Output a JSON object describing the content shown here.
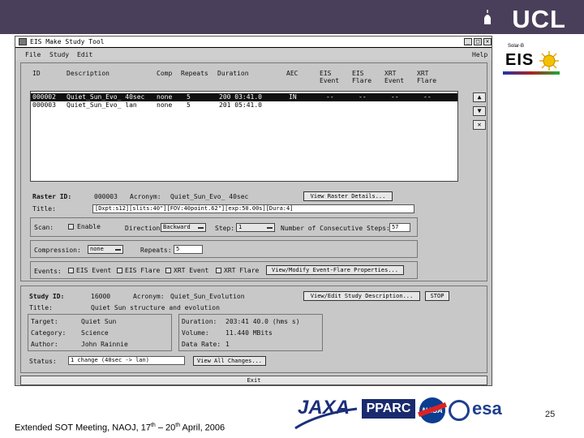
{
  "banner": {
    "logo": "UCL"
  },
  "eis_logo": {
    "small": "Solar-B",
    "text": "EIS"
  },
  "window": {
    "title": "EIS Make Study Tool",
    "title_buttons": [
      "_",
      "□",
      "✕"
    ],
    "menu": {
      "file": "File",
      "study": "Study",
      "edit": "Edit",
      "help": "Help"
    }
  },
  "upper": {
    "headers": {
      "id": "ID",
      "description": "Description",
      "comp": "Comp",
      "repeats": "Repeats",
      "duration": "Duration",
      "aec": "AEC",
      "eis_event": "EIS\nEvent",
      "eis_flare": "EIS\nFlare",
      "xrt_event": "XRT\nEvent",
      "xrt_flare": "XRT\nFlare"
    },
    "rows": [
      {
        "id": "000002",
        "description": "Quiet_Sun_Evo_ 40sec",
        "comp": "none",
        "repeats": "5",
        "duration": "200 03:41.0",
        "aec": "IN",
        "eis_event": "--",
        "eis_flare": "--",
        "xrt_event": "--",
        "xrt_flare": "--"
      },
      {
        "id": "000003",
        "description": "Quiet_Sun_Evo_ lan",
        "comp": "none",
        "repeats": "5",
        "duration": "201 05:41.0"
      }
    ],
    "side_buttons": [
      "▲",
      "▼",
      "✕"
    ],
    "raster_id_label": "Raster ID:",
    "raster_id_value": "000003",
    "acronym_label": "Acronym:",
    "acronym_value": "Quiet_Sun_Evo_ 40sec",
    "view_raster_button": "View Raster Details...",
    "title_label": "Title:",
    "title_value": "[Dxpt:s12][slits:40\"][FOV:40point.62\"][exp:50.00s][Dura:4]",
    "scan_label": "Scan:",
    "enable_label": "Enable",
    "direction_label": "Direction:",
    "direction_value": "Backward",
    "step_label": "Step:",
    "step_value": "1",
    "conseq_label": "Number of Consecutive Steps:",
    "conseq_value": "57",
    "compression_label": "Compression:",
    "compression_value": "none",
    "repeats_label": "Repeats:",
    "repeats_value": "5",
    "events_label": "Events:",
    "eis_event": "EIS Event",
    "eis_flare": "EIS Flare",
    "xrt_event": "XRT Event",
    "xrt_flare": "XRT Flare",
    "event_flare_button": "View/Modify Event-Flare Properties..."
  },
  "lower": {
    "study_id_label": "Study ID:",
    "study_id_value": "16000",
    "acronym_label": "Acronym:",
    "acronym_value": "Quiet_Sun_Evolution",
    "view_study_button": "View/Edit Study Description...",
    "stop_button": "STOP",
    "title_label": "Title:",
    "title_value": "Quiet Sun structure and evolution",
    "target_label": "Target:",
    "target_value": "Quiet Sun",
    "category_label": "Category:",
    "category_value": "Science",
    "author_label": "Author:",
    "author_value": "John Rainnie",
    "duration_label": "Duration:",
    "duration_value": "203:41 40.0 (hms s)",
    "volume_label": "Volume:",
    "volume_value": "11.440 MBits",
    "data_rate_label": "Data Rate:",
    "data_rate_value": "1",
    "status_label": "Status:",
    "status_value": "1 change (40sec -> lan)",
    "view_changes_button": "View All Changes..."
  },
  "exit_button": "Exit",
  "footer": {
    "text_pre": "Extended SOT Meeting, NAOJ, 17",
    "sup1": "th",
    "text_mid": " – 20",
    "sup2": "th",
    "text_post": " April, 2006",
    "page": "25"
  },
  "logos": {
    "jaxa": "JAXA",
    "pparc": "PPARC",
    "nasa": "NASA",
    "esa": "esa"
  }
}
